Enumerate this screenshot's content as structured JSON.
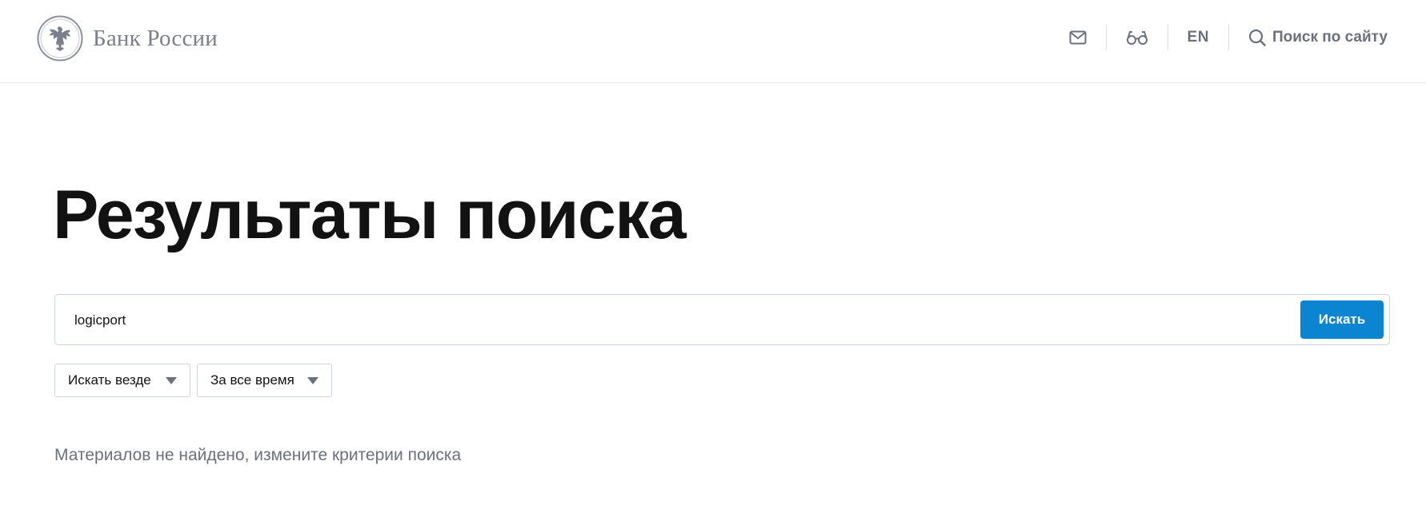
{
  "header": {
    "logo_text": "Банк России",
    "logo_icon": "double-headed-eagle-emblem",
    "tools": {
      "mail_icon": "mail-icon",
      "accessibility_icon": "glasses-icon",
      "lang_label": "EN",
      "search_icon": "search-icon",
      "search_label": "Поиск по сайту"
    }
  },
  "main": {
    "title": "Результаты поиска",
    "search": {
      "value": "logicport",
      "placeholder": "",
      "clear_icon": "close-icon",
      "submit_label": "Искать"
    },
    "filters": [
      {
        "label": "Искать везде",
        "icon": "caret-down-icon"
      },
      {
        "label": "За все время",
        "icon": "caret-down-icon"
      }
    ],
    "no_results_text": "Материалов не найдено, измените критерии поиска"
  },
  "colors": {
    "accent": "#0c85d1",
    "muted_text": "#6b717c",
    "title_text": "#121212",
    "border": "#ced2d9"
  }
}
